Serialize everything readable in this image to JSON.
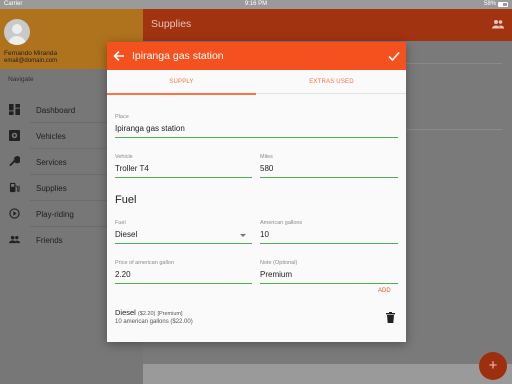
{
  "status_bar": {
    "carrier": "Carrier",
    "time": "9:16 PM",
    "battery": "58%"
  },
  "sidebar": {
    "user_name": "Fernando Miranda",
    "user_email": "email@domain.com",
    "nav_title": "Navigate",
    "items": [
      {
        "label": "Dashboard",
        "icon": "dashboard-icon"
      },
      {
        "label": "Vehicles",
        "icon": "vehicle-icon"
      },
      {
        "label": "Services",
        "icon": "wrench-icon"
      },
      {
        "label": "Supplies",
        "icon": "gas-pump-icon"
      },
      {
        "label": "Play-riding",
        "icon": "play-circle-icon"
      },
      {
        "label": "Friends",
        "icon": "people-icon"
      }
    ]
  },
  "appbar": {
    "title": "Supplies",
    "action_icon": "people-icon"
  },
  "fab": {
    "label": "+"
  },
  "dialog": {
    "title": "Ipiranga gas station",
    "tabs": [
      {
        "label": "SUPPLY"
      },
      {
        "label": "EXTRAS USED"
      }
    ],
    "place": {
      "label": "Place",
      "value": "Ipiranga gas station"
    },
    "vehicle": {
      "label": "Vehicle",
      "value": "Troller T4"
    },
    "miles": {
      "label": "Miles",
      "value": "580"
    },
    "fuel_section_title": "Fuel",
    "fuel": {
      "label": "Fuel",
      "value": "Diesel"
    },
    "gallons": {
      "label": "American gallons",
      "value": "10"
    },
    "price": {
      "label": "Price of american gallon",
      "value": "2.20"
    },
    "note": {
      "label": "Note (Optional)",
      "value": "Premium"
    },
    "add_label": "ADD",
    "entry": {
      "fuel": "Diesel",
      "price": "($2.20)",
      "note": "[Premium]",
      "summary": "10 american gallons ($22.00)"
    }
  },
  "colors": {
    "accent": "#f4511e",
    "field_underline": "#4caf50",
    "sidebar_header": "#b0731d",
    "appbar": "#a23311"
  }
}
